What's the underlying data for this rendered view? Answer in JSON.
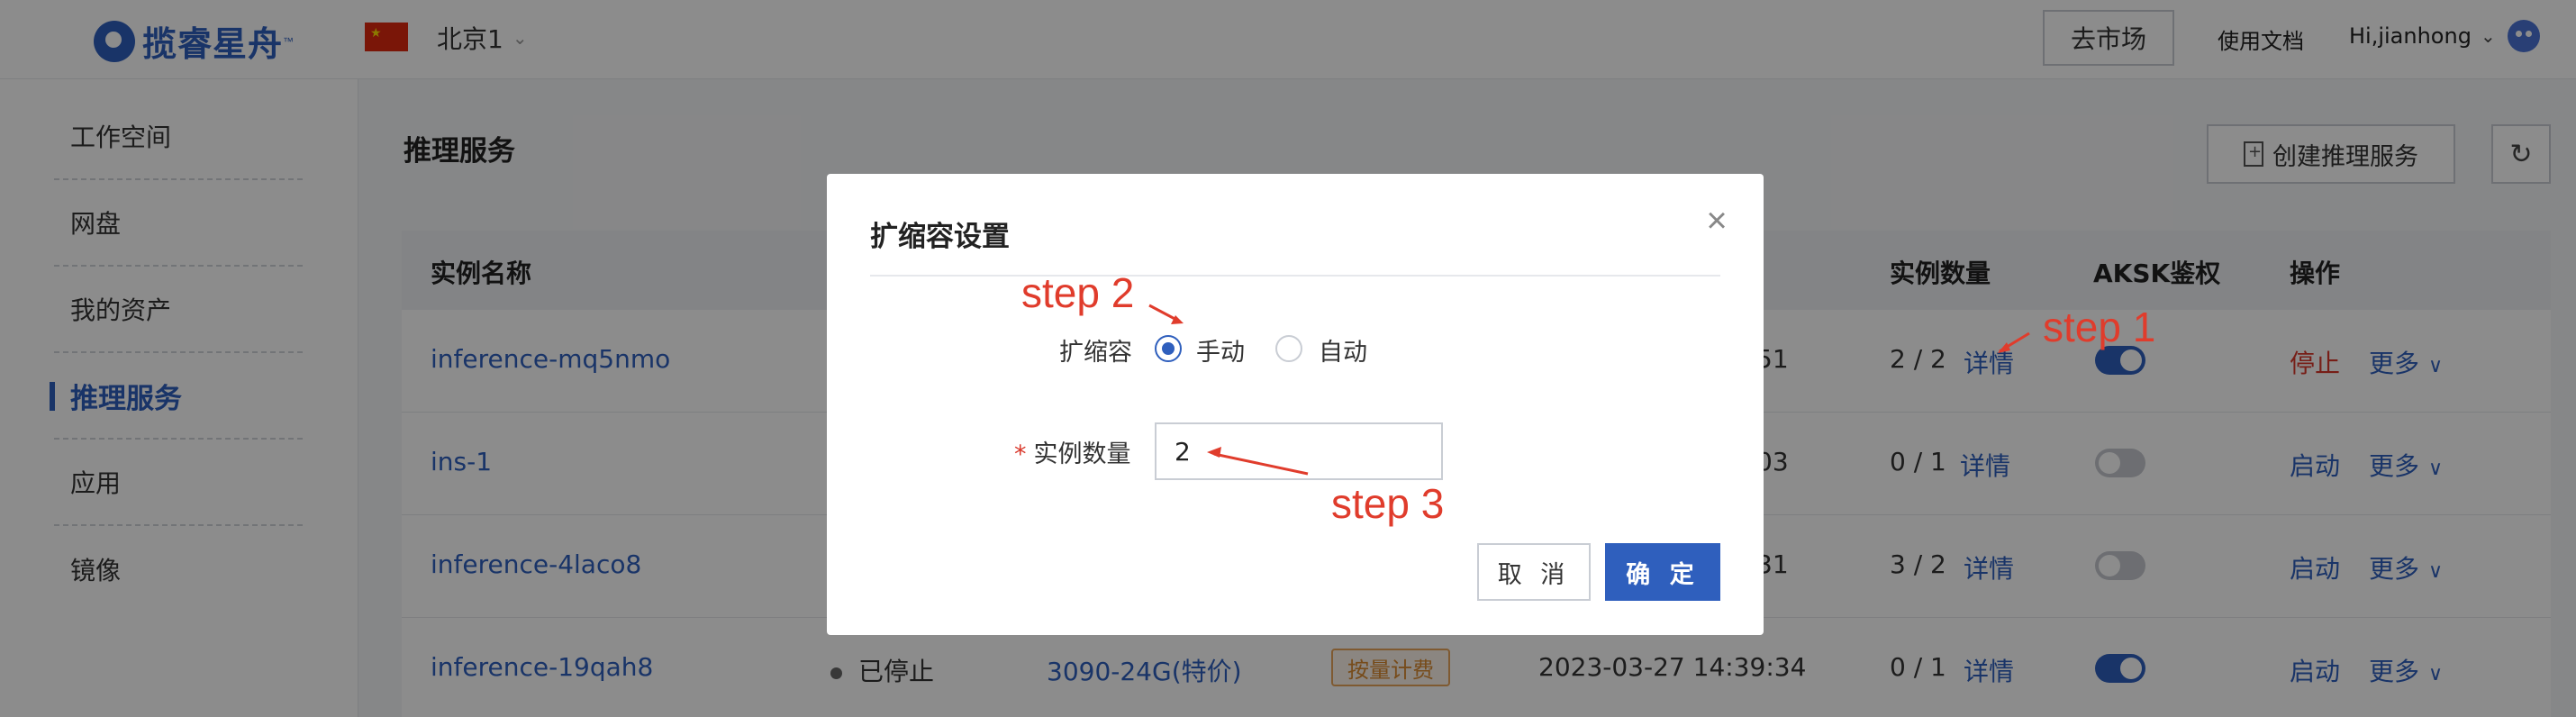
{
  "header": {
    "logo_text": "揽睿星舟",
    "logo_tm": "™",
    "region": "北京1",
    "market_button": "去市场",
    "docs_link": "使用文档",
    "user_greeting": "Hi,jianhong"
  },
  "sidebar": {
    "items": [
      {
        "label": "工作空间"
      },
      {
        "label": "网盘"
      },
      {
        "label": "我的资产"
      },
      {
        "label": "推理服务"
      },
      {
        "label": "应用"
      },
      {
        "label": "镜像"
      }
    ],
    "active_index": 3
  },
  "main": {
    "title": "推理服务",
    "create_button": "创建推理服务"
  },
  "table": {
    "headers": {
      "name": "实例名称",
      "count": "实例数量",
      "aksk": "AKSK鉴权",
      "actions": "操作"
    },
    "rows": [
      {
        "name": "inference-mq5nmo",
        "time_tail": "51",
        "count": "2 / 2",
        "detail": "详情",
        "aksk_on": true,
        "action": "停止",
        "more": "更多"
      },
      {
        "name": "ins-1",
        "time_tail": "03",
        "count": "0 / 1",
        "detail": "详情",
        "aksk_on": false,
        "action": "启动",
        "more": "更多"
      },
      {
        "name": "inference-4laco8",
        "time_tail": "31",
        "count": "3 / 2",
        "detail": "详情",
        "aksk_on": false,
        "action": "启动",
        "more": "更多"
      },
      {
        "name": "inference-19qah8",
        "status": "已停止",
        "spec": "3090-24G(特价)",
        "billing": "按量计费",
        "time": "2023-03-27 14:39:34",
        "count": "0 / 1",
        "detail": "详情",
        "aksk_on": true,
        "action": "启动",
        "more": "更多"
      }
    ]
  },
  "modal": {
    "title": "扩缩容设置",
    "scale_label": "扩缩容",
    "option_manual": "手动",
    "option_auto": "自动",
    "selected": "手动",
    "required_mark": "*",
    "instance_label": "实例数量",
    "instance_value": "2",
    "cancel": "取 消",
    "confirm": "确 定"
  },
  "annotations": {
    "step1": "step 1",
    "step2": "step 2",
    "step3": "step 3",
    "color": "#e03c2c"
  },
  "colors": {
    "primary": "#2f5fbd",
    "danger": "#d9382b",
    "tag": "#d98a32"
  }
}
